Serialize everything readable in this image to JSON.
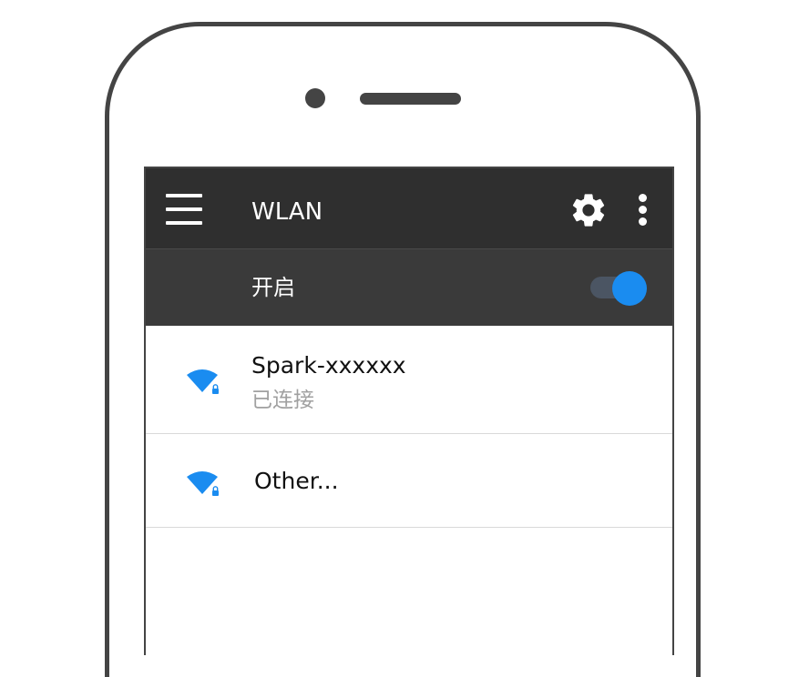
{
  "app": {
    "title": "WLAN"
  },
  "toolbar": {
    "menu_icon": "hamburger-menu-icon",
    "settings_icon": "gear-icon",
    "more_icon": "more-vertical-icon"
  },
  "wlan_toggle": {
    "label": "开启",
    "state": "on",
    "accent_color": "#1a8cf0"
  },
  "networks": [
    {
      "name": "Spark-xxxxxx",
      "status": "已连接",
      "icon": "wifi-locked-icon"
    },
    {
      "name": "Other...",
      "icon": "wifi-locked-icon"
    }
  ],
  "colors": {
    "appbar": "#2f2f2f",
    "toggle_row": "#3a3a3a",
    "wifi_icon": "#1a8cf0",
    "status_text": "#a0a0a0"
  }
}
